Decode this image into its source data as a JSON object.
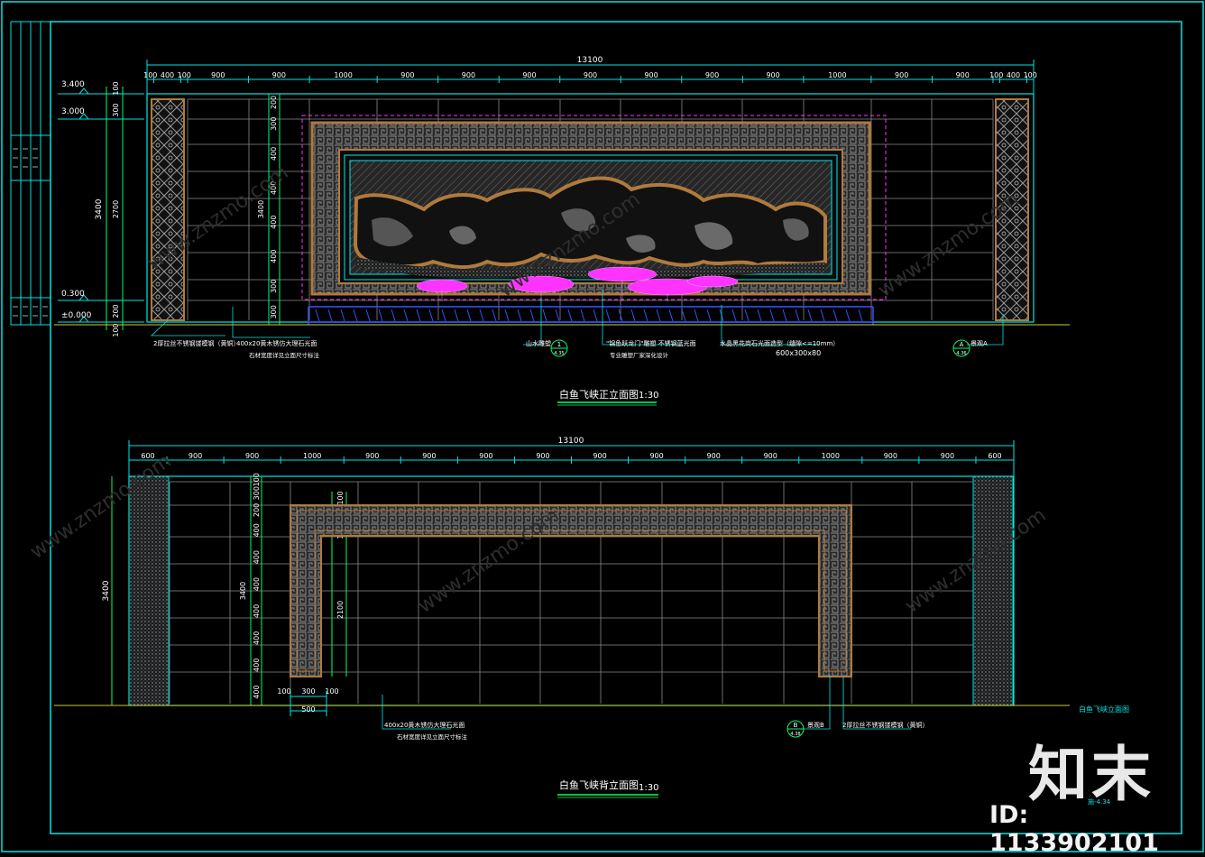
{
  "front_elevation": {
    "title": "白鱼飞峡正立面图",
    "scale": "1:30",
    "total_dim": "13100",
    "top_dims": [
      "100",
      "400",
      "100",
      "900",
      "900",
      "1000",
      "900",
      "900",
      "900",
      "900",
      "900",
      "900",
      "900",
      "1000",
      "900",
      "900",
      "100",
      "400",
      "100"
    ],
    "levels": [
      "3.400",
      "3.000",
      "0.300",
      "±0.000"
    ],
    "left_dims": [
      "100",
      "300",
      "2700",
      "200",
      "100"
    ],
    "left_total": "3400",
    "inner_dims": [
      "200",
      "300",
      "400",
      "400",
      "400",
      "400",
      "300",
      "300"
    ],
    "inner_total": "3400",
    "callouts": [
      {
        "text": "2厚拉丝不锈钢镂模钢（黄铜）"
      },
      {
        "text": "400x20黄木锈仿大理石光面",
        "sub": "石材宽度详见立面尺寸标注"
      },
      {
        "text": "山水雕塑"
      },
      {
        "text": "\"锦鱼跃龙门\"雕塑  不锈钢蓝光面",
        "sub": "专业雕塑厂家深化设计"
      },
      {
        "text": "水晶黑花岗石光面造型（缝隙<=10mm）",
        "sub": "600x300x80"
      },
      {
        "text": "景观A"
      }
    ],
    "markers": [
      {
        "num": "1",
        "sheet": "4.35"
      },
      {
        "num": "A",
        "sheet": "4.36"
      }
    ]
  },
  "back_elevation": {
    "title": "白鱼飞峡背立面图",
    "scale": "1:30",
    "total_dim": "13100",
    "top_dims": [
      "600",
      "900",
      "900",
      "1000",
      "900",
      "900",
      "900",
      "900",
      "900",
      "900",
      "900",
      "900",
      "1000",
      "900",
      "900",
      "600"
    ],
    "left_total": "3400",
    "inner_dims": [
      "100",
      "300",
      "200",
      "400",
      "400",
      "400",
      "400",
      "400",
      "400",
      "400"
    ],
    "inner_total": "3400",
    "frame_dims": [
      "100",
      "100",
      "300",
      "2100"
    ],
    "bottom_dims": [
      "100",
      "300",
      "100",
      "500"
    ],
    "callouts": [
      {
        "text": "400x20黄木锈仿大理石光面",
        "sub": "石材宽度详见立面尺寸标注"
      },
      {
        "text": "景观B"
      },
      {
        "text": "2厚拉丝不锈钢镂模钢（黄铜）"
      }
    ],
    "markers": [
      {
        "num": "B",
        "sheet": "4.38"
      }
    ]
  },
  "side_note": "白鱼飞峡立面图",
  "sheet_ref": "施-4.34",
  "watermark": {
    "brand": "知末",
    "id": "ID: 1133902101",
    "site": "www.znzmo.com"
  },
  "colors": {
    "frame": "#00e5e5",
    "dim": "#00ff66",
    "grid": "#8a8a8a",
    "callout": "#ffffff",
    "accent_magenta": "#ff33ff",
    "brown": "#b07a3c",
    "blue": "#3355ff"
  }
}
